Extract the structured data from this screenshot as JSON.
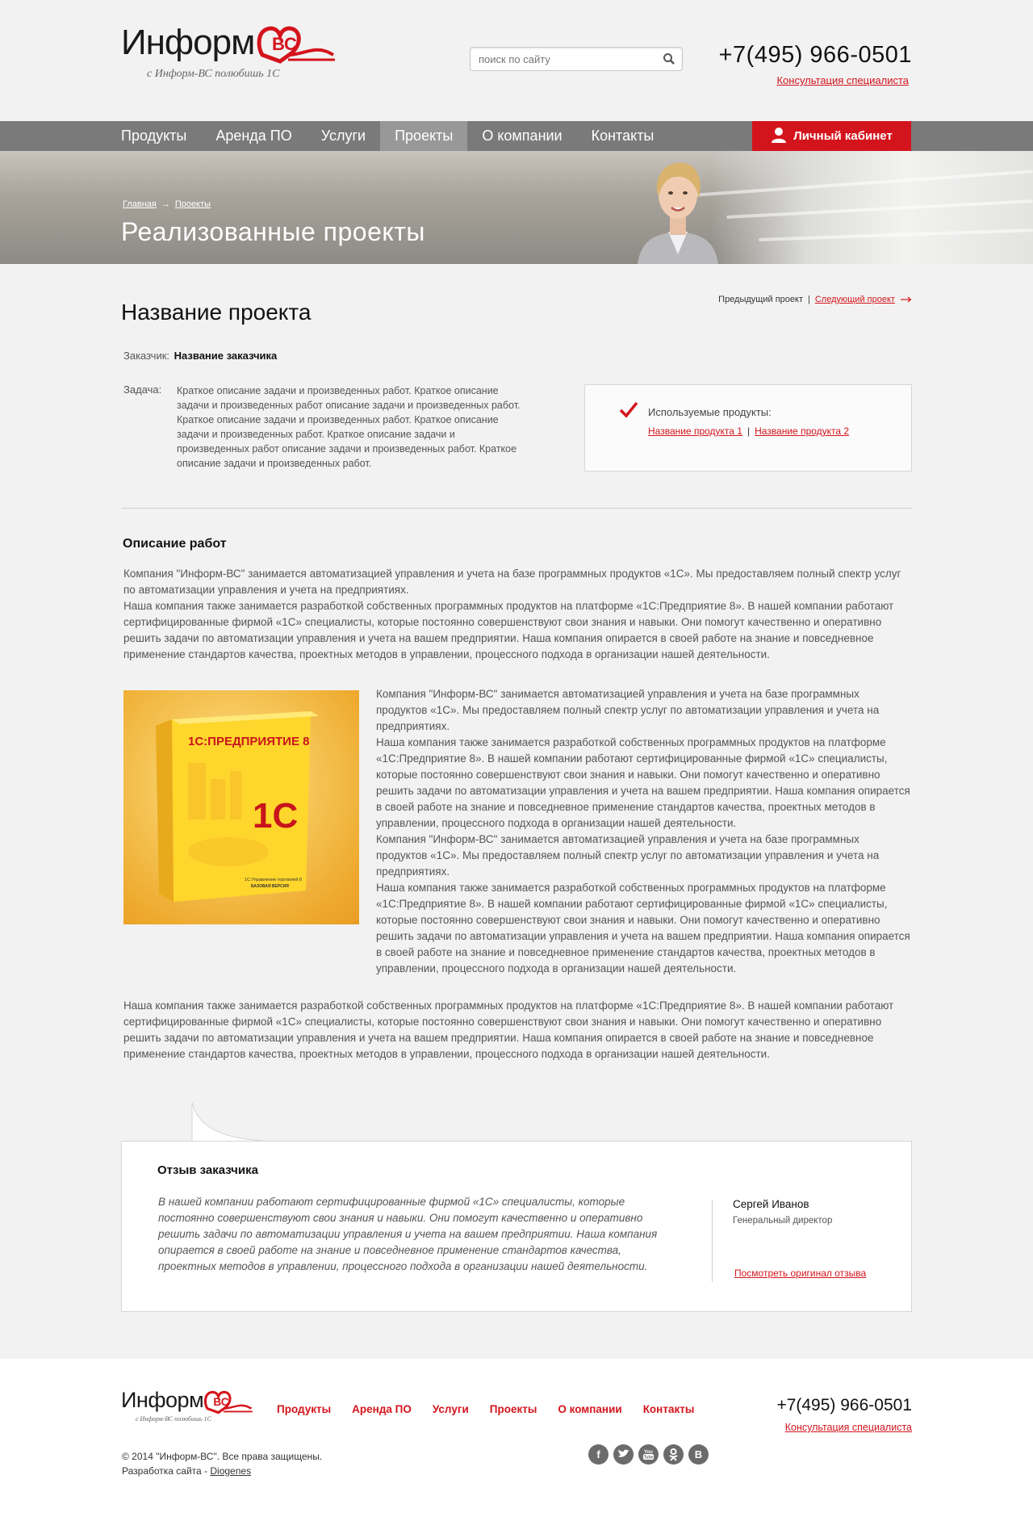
{
  "header": {
    "logo_text": "Информ",
    "logo_mark": "ВС",
    "slogan": "с Информ-ВС полюбишь 1С",
    "search_placeholder": "поиск по сайту",
    "phone": "+7(495) 966-0501",
    "consult_link": "Консультация специалиста"
  },
  "nav": {
    "items": [
      {
        "label": "Продукты"
      },
      {
        "label": "Аренда ПО"
      },
      {
        "label": "Услуги"
      },
      {
        "label": "Проекты",
        "active": true
      },
      {
        "label": "О компании"
      },
      {
        "label": "Контакты"
      }
    ],
    "cabinet": "Личный кабинет"
  },
  "banner": {
    "breadcrumbs": [
      "Главная",
      "Проекты"
    ],
    "title": "Реализованные проекты"
  },
  "project": {
    "title": "Название проекта",
    "prev": "Предыдущий проект",
    "next": "Следующий проект",
    "customer_label": "Заказчик:",
    "customer_name": "Название заказчика",
    "task_label": "Задача:",
    "task_text": "Краткое описание задачи и произведенных работ. Краткое описание задачи и произведенных работ описание задачи и произведенных работ. Краткое описание задачи и произведенных работ. Краткое описание задачи и произведенных работ. Краткое описание задачи и произведенных работ описание задачи и произведенных работ. Краткое описание задачи и произведенных работ.",
    "products_label": "Используемые продукты:",
    "products": [
      "Название продукта 1",
      "Название продукта 2"
    ]
  },
  "works": {
    "title": "Описание работ",
    "p1": "Компания \"Информ-ВС\" занимается автоматизацией управления и учета на базе программных продуктов «1С». Мы предоставляем полный спектр услуг по автоматизации управления и учета на предприятиях.",
    "p1b": "Наша компания также занимается разработкой собственных программных продуктов на платформе «1С:Предприятие 8». В нашей компании работают сертифицированные фирмой «1С» специалисты, которые постоянно совершенствуют свои знания и навыки. Они помогут качественно и оперативно решить задачи по автоматизации управления и учета на вашем предприятии. Наша компания опирается в своей работе на знание и повседневное применение стандартов качества, проектных методов в управлении, процессного подхода в организации нашей деятельности.",
    "p2a": "Компания \"Информ-ВС\" занимается автоматизацией управления и учета на базе программных продуктов «1С». Мы предоставляем полный спектр услуг по автоматизации управления и учета на предприятиях.",
    "p2b": "Наша компания также занимается разработкой собственных программных продуктов на платформе «1С:Предприятие 8». В нашей компании работают сертифицированные фирмой «1С» специалисты, которые постоянно совершенствуют свои знания и навыки. Они помогут качественно и оперативно решить задачи по автоматизации управления и учета на вашем предприятии. Наша компания опирается в своей работе на знание и повседневное применение стандартов качества, проектных методов в управлении, процессного подхода в организации нашей деятельности.",
    "p2c": "Компания \"Информ-ВС\" занимается автоматизацией управления и учета на базе программных продуктов «1С». Мы предоставляем полный спектр услуг по автоматизации управления и учета на предприятиях.",
    "p2d": "Наша компания также занимается разработкой собственных программных продуктов на платформе «1С:Предприятие 8». В нашей компании работают сертифицированные фирмой «1С» специалисты, которые постоянно совершенствуют свои знания и навыки. Они помогут качественно и оперативно решить задачи по автоматизации управления и учета на вашем предприятии. Наша компания опирается в своей работе на знание и повседневное применение стандартов качества, проектных методов в управлении, процессного подхода в организации нашей деятельности.",
    "p3": "Наша компания также занимается разработкой собственных программных продуктов на платформе «1С:Предприятие 8». В нашей компании работают сертифицированные фирмой «1С» специалисты, которые постоянно совершенствуют свои знания и навыки. Они помогут качественно и оперативно решить задачи по автоматизации управления и учета на вашем предприятии. Наша компания опирается в своей работе на знание и повседневное применение стандартов качества, проектных методов в управлении, процессного подхода в организации нашей деятельности.",
    "box_title": "1С:ПРЕДПРИЯТИЕ 8",
    "box_logo": "1С",
    "box_sub1": "1С:Управление торговлей 8",
    "box_sub2": "БАЗОВАЯ ВЕРСИЯ"
  },
  "review": {
    "title": "Отзыв заказчика",
    "text": "В нашей компании работают сертифицированные фирмой «1С» специалисты, которые постоянно совершенствуют свои знания и навыки. Они помогут качественно и оперативно решить задачи по автоматизации управления и учета на вашем предприятии. Наша компания опирается в своей работе на знание и повседневное применение стандартов качества, проектных методов в управлении, процессного подхода в организации нашей деятельности.",
    "name": "Сергей Иванов",
    "position": "Генеральный директор",
    "link": "Посмотреть оригинал отзыва"
  },
  "footer": {
    "logo_text": "Информ",
    "slogan": "с Информ-ВС полюбишь 1С",
    "nav": [
      "Продукты",
      "Аренда ПО",
      "Услуги",
      "Проекты",
      "О компании",
      "Контакты"
    ],
    "phone": "+7(495) 966-0501",
    "consult_link": "Консультация специалиста",
    "copyright": "© 2014 \"Информ-ВС\". Все права защищены.",
    "dev_label": "Разработка сайта - ",
    "dev_link": "Diogenes",
    "socials": [
      "f",
      "t",
      "yt",
      "ok",
      "B"
    ]
  },
  "colors": {
    "accent": "#d4141c",
    "nav_bg": "#7a7a7a",
    "page_bg": "#f2f2f2"
  }
}
